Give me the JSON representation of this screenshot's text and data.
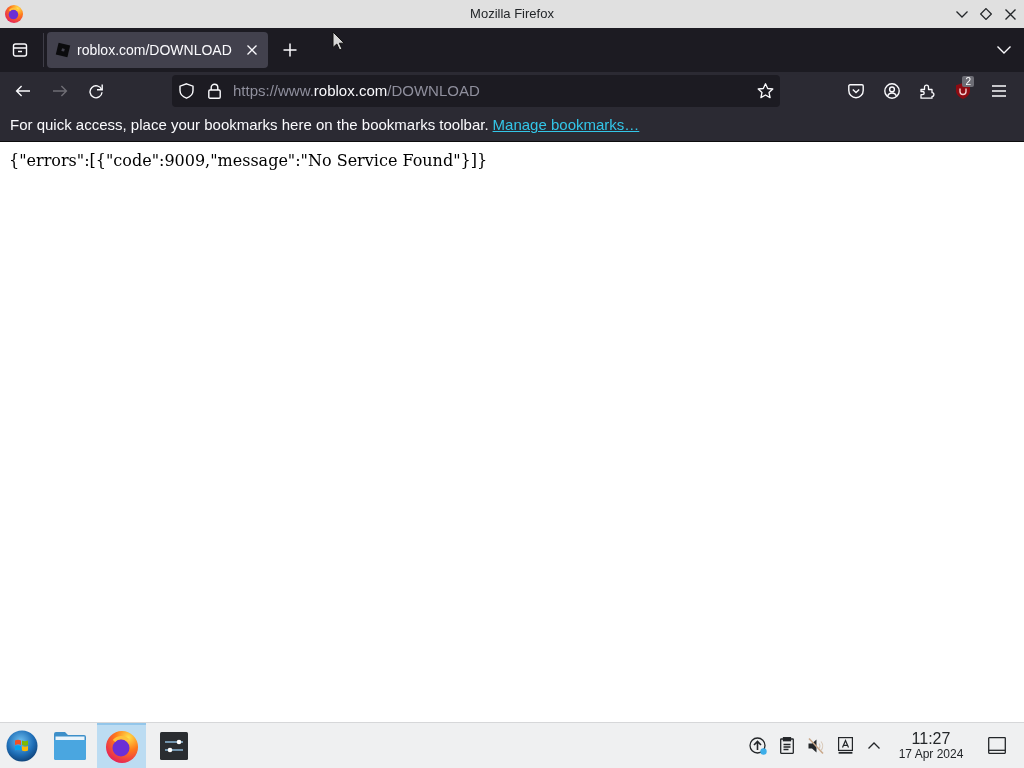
{
  "window": {
    "title": "Mozilla Firefox"
  },
  "tabs": [
    {
      "label": "roblox.com/DOWNLOAD",
      "selected": true
    }
  ],
  "nav_buttons": [
    {
      "kind": "back",
      "disabled": false
    },
    {
      "kind": "forward",
      "disabled": true
    },
    {
      "kind": "reload",
      "disabled": false
    }
  ],
  "address_bar": {
    "url": {
      "prefix": "https://www.",
      "domain": "roblox.com",
      "path": "/DOWNLOAD"
    }
  },
  "toolbar": {
    "extension_badge": "2"
  },
  "bookmarks_bar": {
    "message": "For quick access, place your bookmarks here on the bookmarks toolbar.",
    "link": "Manage bookmarks…"
  },
  "page": {
    "text": "{\"errors\":[{\"code\":9009,\"message\":\"No Service Found\"}]}"
  },
  "taskbar": {
    "apps": [
      {
        "kind": "files",
        "selected": false
      },
      {
        "kind": "browser",
        "selected": true
      },
      {
        "kind": "mixer",
        "selected": false
      }
    ],
    "tray": [
      {
        "kind": "update"
      },
      {
        "kind": "clipboard"
      },
      {
        "kind": "volume",
        "muted": true
      },
      {
        "kind": "input"
      },
      {
        "kind": "expand"
      }
    ],
    "clock": {
      "time": "11:27",
      "date": "17 Apr 2024"
    }
  }
}
